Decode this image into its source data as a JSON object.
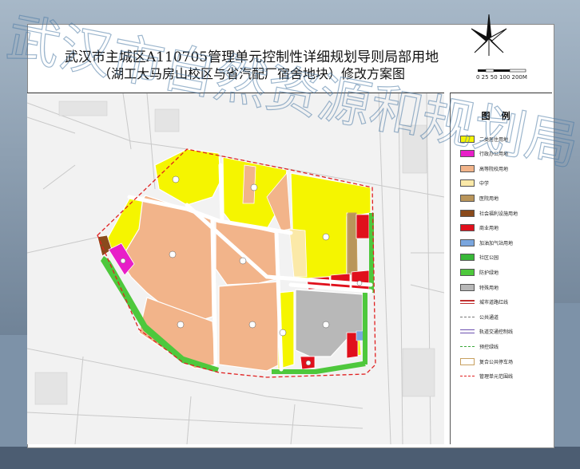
{
  "title": {
    "line1": "武汉市主城区A110705管理单元控制性详细规划导则局部用地",
    "line2": "（湖工大马房山校区与省汽配厂宿舍地块）修改方案图"
  },
  "scale_bar": {
    "label": "0 25 50  100      200M"
  },
  "watermark": {
    "text": "武汉市自然资源和规划局"
  },
  "legend": {
    "title": "图例",
    "items": [
      {
        "code": "R2",
        "label": "二类居住用地",
        "color": "#f5f500",
        "kind": "swatch"
      },
      {
        "code": "A1",
        "label": "行政办公用地",
        "color": "#e81ec8",
        "kind": "swatch"
      },
      {
        "code": "A31",
        "label": "高等院校用地",
        "color": "#f2b48a",
        "kind": "swatch"
      },
      {
        "code": "A33",
        "label": "中学",
        "color": "#fbe9a8",
        "kind": "swatch"
      },
      {
        "code": "A5",
        "label": "医院用地",
        "color": "#b9955a",
        "kind": "swatch"
      },
      {
        "code": "A6",
        "label": "社会福利设施用地",
        "color": "#8a4a1c",
        "kind": "swatch"
      },
      {
        "code": "B1",
        "label": "商业用地",
        "color": "#e0101c",
        "kind": "swatch"
      },
      {
        "code": "B41",
        "label": "加油加气站用地",
        "color": "#7aa6de",
        "kind": "swatch"
      },
      {
        "code": "G1",
        "label": "社区公园",
        "color": "#38b838",
        "kind": "swatch"
      },
      {
        "code": "G2",
        "label": "防护绿地",
        "color": "#4ec83c",
        "kind": "swatch"
      },
      {
        "code": "U",
        "label": "特殊用地",
        "color": "#b8b8b8",
        "kind": "swatch"
      },
      {
        "code": "",
        "label": "城市道路红线",
        "color": "#c03030",
        "kind": "line-red"
      },
      {
        "code": "",
        "label": "公共通道",
        "color": "#777777",
        "kind": "line-dash"
      },
      {
        "code": "",
        "label": "轨道交通控制线",
        "color": "#6c4fb0",
        "kind": "line-purple"
      },
      {
        "code": "",
        "label": "预控绿线",
        "color": "#3aa83a",
        "kind": "line-green"
      },
      {
        "code": "",
        "label": "复合公共停车场",
        "color": "#c8a060",
        "kind": "swatch-outline"
      },
      {
        "code": "",
        "label": "管理单元范围线",
        "color": "#e02020",
        "kind": "line-boundary"
      }
    ]
  },
  "colors": {
    "residential": "#f5f500",
    "university": "#f2b48a",
    "commercial": "#e0101c",
    "special": "#b8b8b8",
    "green": "#4ec83c",
    "office": "#e81ec8",
    "welfare": "#8a4a1c",
    "hospital": "#b9955a",
    "school": "#fbe9a8",
    "gas": "#7aa6de",
    "road": "#d9d9d9",
    "boundary": "#e02020"
  }
}
